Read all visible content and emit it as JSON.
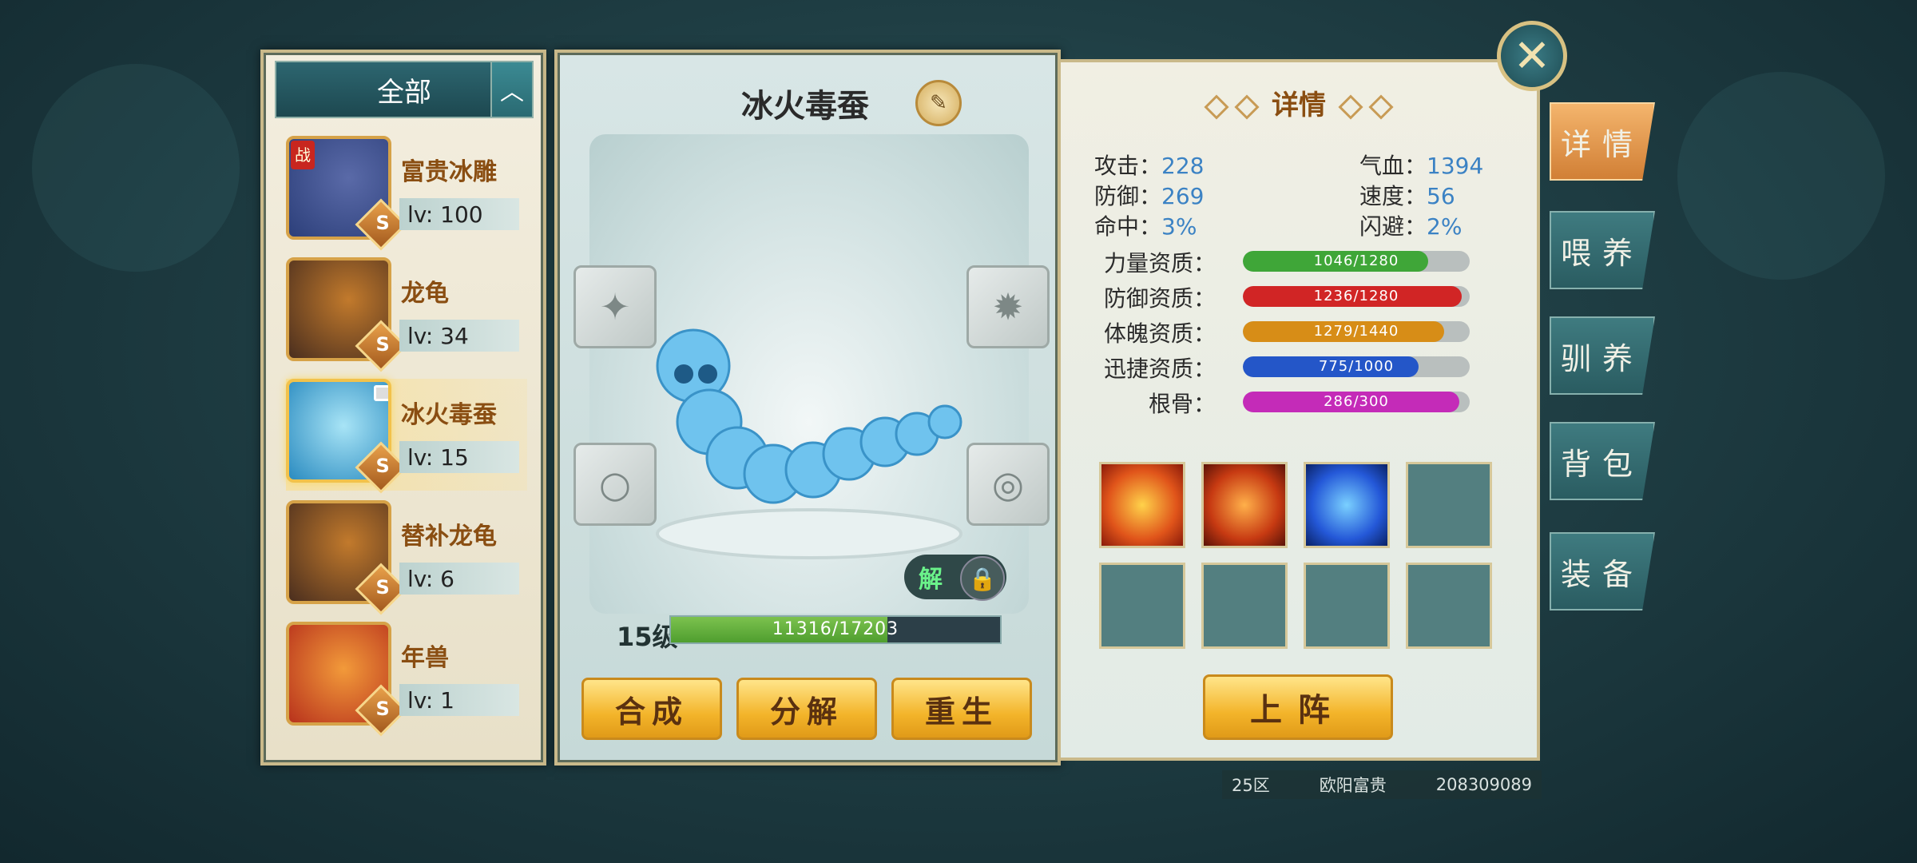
{
  "list": {
    "filter_label": "全部",
    "filter_toggle_icon": "chevron-up-icon",
    "pets": [
      {
        "name": "富贵冰雕",
        "level": "lv: 100",
        "rank": "S",
        "war_tag": "战",
        "colors": [
          "#2c3f7a",
          "#5a6aa8"
        ]
      },
      {
        "name": "龙龟",
        "level": "lv: 34",
        "rank": "S",
        "colors": [
          "#4a2e1e",
          "#c27a2c"
        ]
      },
      {
        "name": "冰火毒蚕",
        "level": "lv: 15",
        "rank": "S",
        "selected": true,
        "locked": true,
        "colors": [
          "#6cc8ea",
          "#2a8bc0"
        ]
      },
      {
        "name": "替补龙龟",
        "level": "lv: 6",
        "rank": "S",
        "colors": [
          "#4a2e1e",
          "#c27a2c"
        ]
      },
      {
        "name": "年兽",
        "level": "lv: 1",
        "rank": "S",
        "colors": [
          "#b8321c",
          "#f29a3a"
        ]
      }
    ]
  },
  "center": {
    "pet_title": "冰火毒蚕",
    "edit_icon": "pencil-icon",
    "lock_toggle_label": "解",
    "level_label": "15级",
    "exp_text": "11316/17203",
    "exp_fraction": 0.658,
    "buttons": {
      "combine": "合成",
      "decompose": "分解",
      "rebirth": "重生"
    }
  },
  "detail": {
    "title": "详情",
    "stats": {
      "attack_label": "攻击：",
      "attack": "228",
      "hp_label": "气血：",
      "hp": "1394",
      "defense_label": "防御：",
      "defense": "269",
      "speed_label": "速度：",
      "speed": "56",
      "hit_label": "命中：",
      "hit": "3%",
      "dodge_label": "闪避：",
      "dodge": "2%"
    },
    "aptitudes": [
      {
        "label": "力量资质：",
        "value": "1046/1280",
        "fraction": 0.817,
        "color": "#3fa638"
      },
      {
        "label": "防御资质：",
        "value": "1236/1280",
        "fraction": 0.966,
        "color": "#d12525"
      },
      {
        "label": "体魄资质：",
        "value": "1279/1440",
        "fraction": 0.888,
        "color": "#d78d17"
      },
      {
        "label": "迅捷资质：",
        "value": "775/1000",
        "fraction": 0.775,
        "color": "#2456c8"
      },
      {
        "label": "根骨：",
        "value": "286/300",
        "fraction": 0.953,
        "color": "#c42bb8"
      }
    ],
    "deploy_label": "上阵"
  },
  "side_tabs": [
    "详情",
    "喂养",
    "驯养",
    "背包",
    "装备"
  ],
  "footer": {
    "server": "25区",
    "player": "欧阳富贵",
    "player_id": "208309089"
  }
}
